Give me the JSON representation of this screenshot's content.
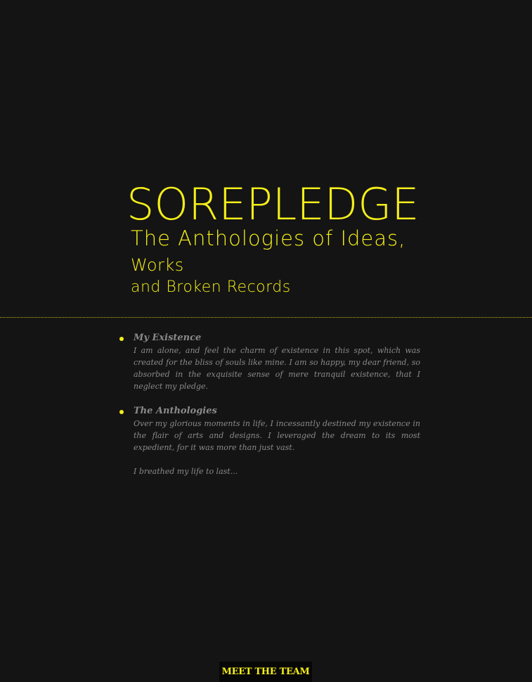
{
  "hero": {
    "brand": "SOREPLEDGE",
    "tagline_line1": "The Anthologies of Ideas,",
    "tagline_line2": "Works",
    "tagline_line3": "and Broken Records"
  },
  "entries": [
    {
      "title": "My Existence",
      "body": "I am alone, and feel the charm of existence in this spot, which was created for the bliss of souls like mine. I am so happy, my dear friend, so absorbed in the exquisite sense of mere tranquil existence, that I neglect my pledge."
    },
    {
      "title": "The Anthologies",
      "body": "Over my glorious moments in life, I incessantly destined my existence in the flair of arts and designs. I leveraged the dream to its most expedient, for it was more than just vast.",
      "extra": "I breathed my life to last..."
    }
  ],
  "cta": {
    "label": "MEET THE TEAM"
  },
  "colors": {
    "background": "#141414",
    "accent": "#f4ee1a",
    "body_text": "#8a8a8a"
  }
}
